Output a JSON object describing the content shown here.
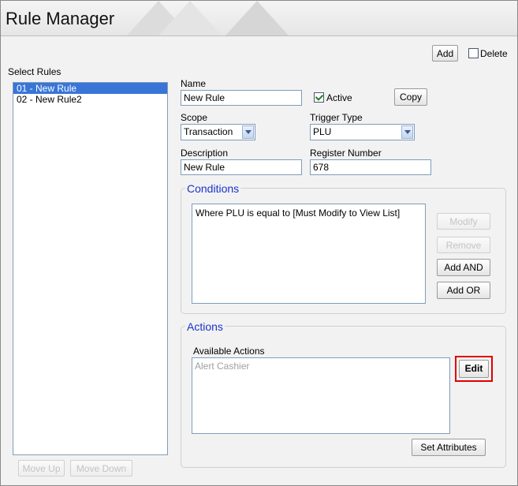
{
  "app": {
    "title": "Rule Manager"
  },
  "toolbar": {
    "add_label": "Add",
    "delete_label": "Delete"
  },
  "rules": {
    "label": "Select Rules",
    "items": [
      {
        "label": "01 - New Rule",
        "selected": true
      },
      {
        "label": "02 - New Rule2",
        "selected": false
      }
    ],
    "move_up_label": "Move Up",
    "move_down_label": "Move Down"
  },
  "form": {
    "name_label": "Name",
    "name_value": "New Rule",
    "active_label": "Active",
    "active_checked": true,
    "copy_label": "Copy",
    "scope_label": "Scope",
    "scope_value": "Transaction",
    "trigger_label": "Trigger Type",
    "trigger_value": "PLU",
    "description_label": "Description",
    "description_value": "New Rule",
    "register_label": "Register Number",
    "register_value": "678"
  },
  "conditions": {
    "title": "Conditions",
    "text": "Where PLU is equal to [Must Modify to View List]",
    "modify_label": "Modify",
    "remove_label": "Remove",
    "add_and_label": "Add AND",
    "add_or_label": "Add OR"
  },
  "actions": {
    "title": "Actions",
    "available_label": "Available Actions",
    "items": [
      "Alert Cashier"
    ],
    "edit_label": "Edit",
    "set_attributes_label": "Set Attributes"
  },
  "colors": {
    "accent": "#3875d7",
    "group_title": "#1a33cc",
    "highlight": "#e00000"
  }
}
